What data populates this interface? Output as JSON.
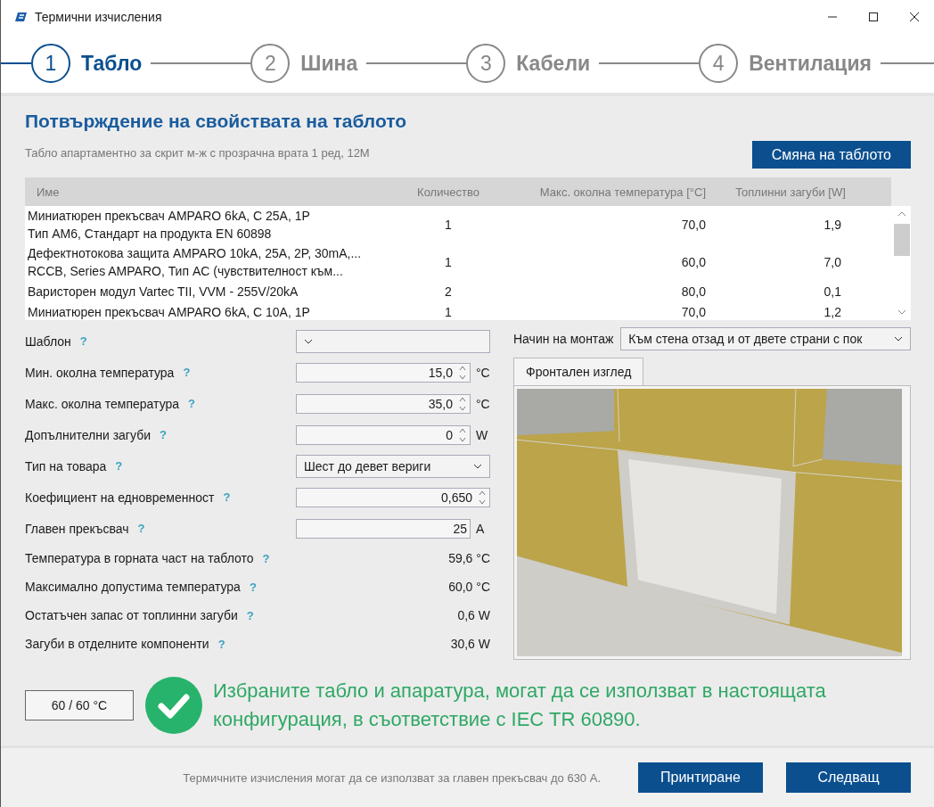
{
  "window": {
    "title": "Термични изчисления"
  },
  "steps": [
    {
      "number": "1",
      "label": "Табло",
      "selected": true
    },
    {
      "number": "2",
      "label": "Шина",
      "selected": false
    },
    {
      "number": "3",
      "label": "Кабели",
      "selected": false
    },
    {
      "number": "4",
      "label": "Вентилация",
      "selected": false
    }
  ],
  "heading": "Потвърждение на свойствата на таблото",
  "subtitle": "Табло апартаментно за скрит м-ж с прозрачна врата 1 ред, 12M",
  "change_button": "Смяна на таблото",
  "table": {
    "columns": [
      "Име",
      "Количество",
      "Макс. околна температура [°C]",
      "Топлинни загуби [W]"
    ],
    "rows": [
      {
        "name": [
          "Миниатюрен  прекъсвач AMPARO 6kA, C 25A, 1P",
          "Тип АМ6, Стандарт на продукта EN 60898"
        ],
        "quantity": "1",
        "max_temp": "70,0",
        "loss": "1,9"
      },
      {
        "name": [
          "Дефектнотокова защита AMPARO 10kA, 25A, 2P, 30mA,...",
          "RCCB, Series AMPARO, Тип AC (чувствителност към..."
        ],
        "quantity": "1",
        "max_temp": "60,0",
        "loss": "7,0"
      },
      {
        "name": [
          "Варисторен модул Vartec TII, VVM - 255V/20kA"
        ],
        "quantity": "2",
        "max_temp": "80,0",
        "loss": "0,1"
      },
      {
        "name": [
          "Миниатюрен прекъсвач AMPARO 6kA, C 10A, 1P"
        ],
        "quantity": "1",
        "max_temp": "70,0",
        "loss": "1,2"
      }
    ]
  },
  "form": [
    {
      "label": "Шаблон",
      "help": "?",
      "kind": "combo"
    },
    {
      "label": "Мин. околна температура",
      "help": "?",
      "kind": "spin",
      "value": "15,0",
      "unit": "°C"
    },
    {
      "label": "Макс. околна температура",
      "help": "?",
      "kind": "spin",
      "value": "35,0",
      "unit": "°C"
    },
    {
      "label": "Допълнителни загуби",
      "help": "?",
      "kind": "spin",
      "value": "0",
      "unit": "W"
    },
    {
      "label": "Тип на товара",
      "help": "?",
      "kind": "combo",
      "value": "Шест до девет вериги"
    },
    {
      "label": "Коефициент на едновременност",
      "help": "?",
      "kind": "spin",
      "value": "0,650"
    },
    {
      "label": "Главен прекъсвач",
      "help": "?",
      "kind": "input",
      "value": "25",
      "unit": "A"
    },
    {
      "label": "Температура в горната част на таблото",
      "help": "?",
      "kind": "readout",
      "value": "59,6 °C"
    },
    {
      "label": "Максимално допустима температура",
      "help": "?",
      "kind": "readout",
      "value": "60,0 °C"
    },
    {
      "label": "Остатъчен запас от топлинни загуби",
      "help": "?",
      "kind": "readout",
      "value": "0,6 W"
    },
    {
      "label": "Загуби в отделните компоненти",
      "help": "?",
      "kind": "readout",
      "value": "30,6 W"
    }
  ],
  "mounting": {
    "label": "Начин на монтаж",
    "value": "Към стена отзад и от двете страни с пок"
  },
  "view_tab": {
    "label": "Фронтален изглед",
    "selected": true
  },
  "result": {
    "reading": "60 / 60 °C",
    "ok": true,
    "message": "Избраните табло и апаратура, могат да се използват в настоящата конфигурация, в съответствие с IEC TR 60890."
  },
  "footer": {
    "note": "Термичните изчисления могат да се използват за главен прекъсвач до 630 A.",
    "buttons": [
      "Принтиране",
      "Следващ"
    ]
  }
}
